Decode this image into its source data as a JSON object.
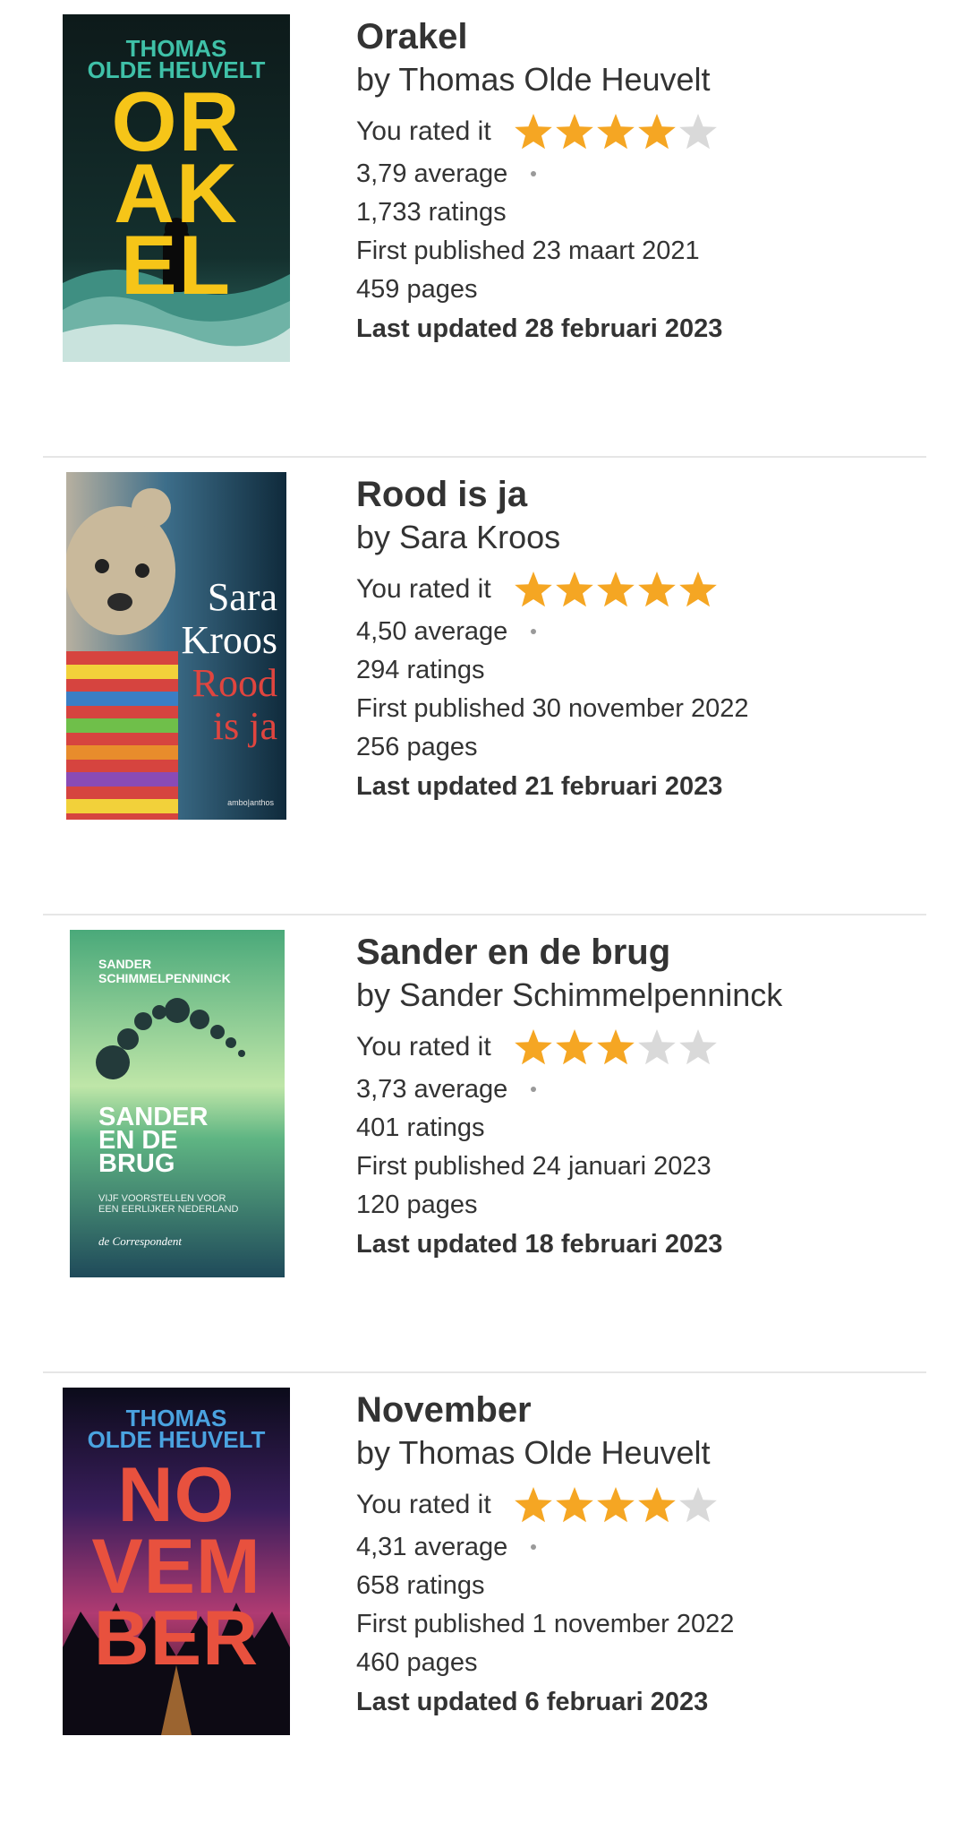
{
  "rated_label": "You rated it",
  "star_colors": {
    "filled": "#f5a623",
    "empty": "#d9d9d9"
  },
  "books": [
    {
      "title": "Orakel",
      "author": "by Thomas Olde Heuvelt",
      "user_rating": 4,
      "average": "3,79 average",
      "ratings": "1,733 ratings",
      "first_published": "First published 23 maart 2021",
      "pages": "459 pages",
      "last_updated": "Last updated 28 februari 2023",
      "cover": {
        "line1": "THOMAS",
        "line2": "OLDE HEUVELT",
        "big1": "OR",
        "big2": "AK",
        "big3": "EL"
      }
    },
    {
      "title": "Rood is ja",
      "author": "by Sara Kroos",
      "user_rating": 5,
      "average": "4,50 average",
      "ratings": "294 ratings",
      "first_published": "First published 30 november 2022",
      "pages": "256 pages",
      "last_updated": "Last updated 21 februari 2023",
      "cover": {
        "line1": "Sara",
        "line2": "Kroos",
        "line3": "Rood",
        "line4": "is ja",
        "publisher": "ambo|anthos"
      }
    },
    {
      "title": "Sander en de brug",
      "author": "by Sander Schimmelpenninck",
      "user_rating": 3,
      "average": "3,73 average",
      "ratings": "401 ratings",
      "first_published": "First published 24 januari 2023",
      "pages": "120 pages",
      "last_updated": "Last updated 18 februari 2023",
      "cover": {
        "line1": "SANDER",
        "line2": "SCHIMMELPENNINCK",
        "big1": "SANDER",
        "big2": "EN DE",
        "big3": "BRUG",
        "sub1": "VIJF VOORSTELLEN VOOR",
        "sub2": "EEN EERLIJKER NEDERLAND",
        "publisher": "de Correspondent"
      }
    },
    {
      "title": "November",
      "author": "by Thomas Olde Heuvelt",
      "user_rating": 4,
      "average": "4,31 average",
      "ratings": "658 ratings",
      "first_published": "First published 1 november 2022",
      "pages": "460 pages",
      "last_updated": "Last updated 6 februari 2023",
      "cover": {
        "line1": "THOMAS",
        "line2": "OLDE HEUVELT",
        "big1": "NO",
        "big2": "VEM",
        "big3": "BER"
      }
    }
  ]
}
